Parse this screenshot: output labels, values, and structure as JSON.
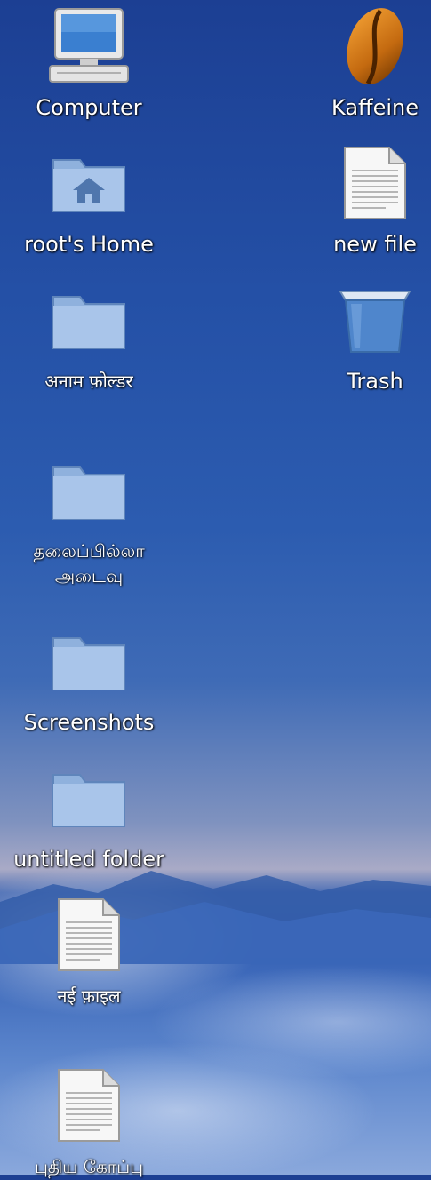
{
  "desktop": {
    "icons": [
      {
        "label": "Computer",
        "icon": "computer-icon"
      },
      {
        "label": "Kaffeine",
        "icon": "kaffeine-icon"
      },
      {
        "label": "root's Home",
        "icon": "home-folder-icon"
      },
      {
        "label": "new file",
        "icon": "text-file-icon"
      },
      {
        "label": "अनाम फ़ोल्डर",
        "icon": "folder-icon"
      },
      {
        "label": "Trash",
        "icon": "trash-icon"
      },
      {
        "label": "தலைப்பில்லா\nஅடைவு",
        "icon": "folder-icon"
      },
      {
        "label": "Screenshots",
        "icon": "folder-icon"
      },
      {
        "label": "untitled folder",
        "icon": "folder-icon"
      },
      {
        "label": "नई फ़ाइल",
        "icon": "text-file-icon"
      },
      {
        "label": "புதிய கோப்பு",
        "icon": "text-file-icon"
      }
    ]
  }
}
